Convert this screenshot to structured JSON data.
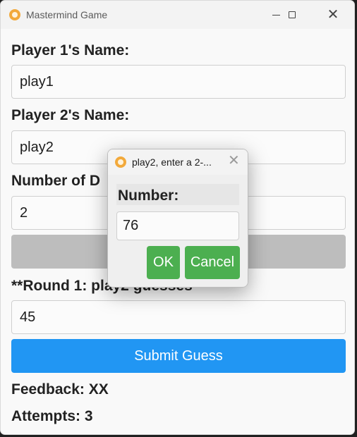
{
  "window": {
    "title": "Mastermind Game",
    "minimize_icon": "minimize-icon",
    "maximize_icon": "maximize-icon",
    "close_icon": "close-icon"
  },
  "form": {
    "player1_label": "Player 1's Name:",
    "player1_value": "play1",
    "player2_label": "Player 2's Name:",
    "player2_value": "play2",
    "digits_label": "Number of D",
    "digits_value": "2",
    "round_label": "**Round 1: play2 guesses",
    "guess_value": "45",
    "submit_label": "Submit Guess",
    "feedback": "Feedback: XX",
    "attempts": "Attempts: 3"
  },
  "dialog": {
    "title": "play2, enter a 2-...",
    "label": "Number:",
    "value": "76",
    "ok_label": "OK",
    "cancel_label": "Cancel"
  },
  "colors": {
    "submit": "#2196f3",
    "dialog_buttons": "#4caf50",
    "disabled_button": "#bdbdbd"
  }
}
